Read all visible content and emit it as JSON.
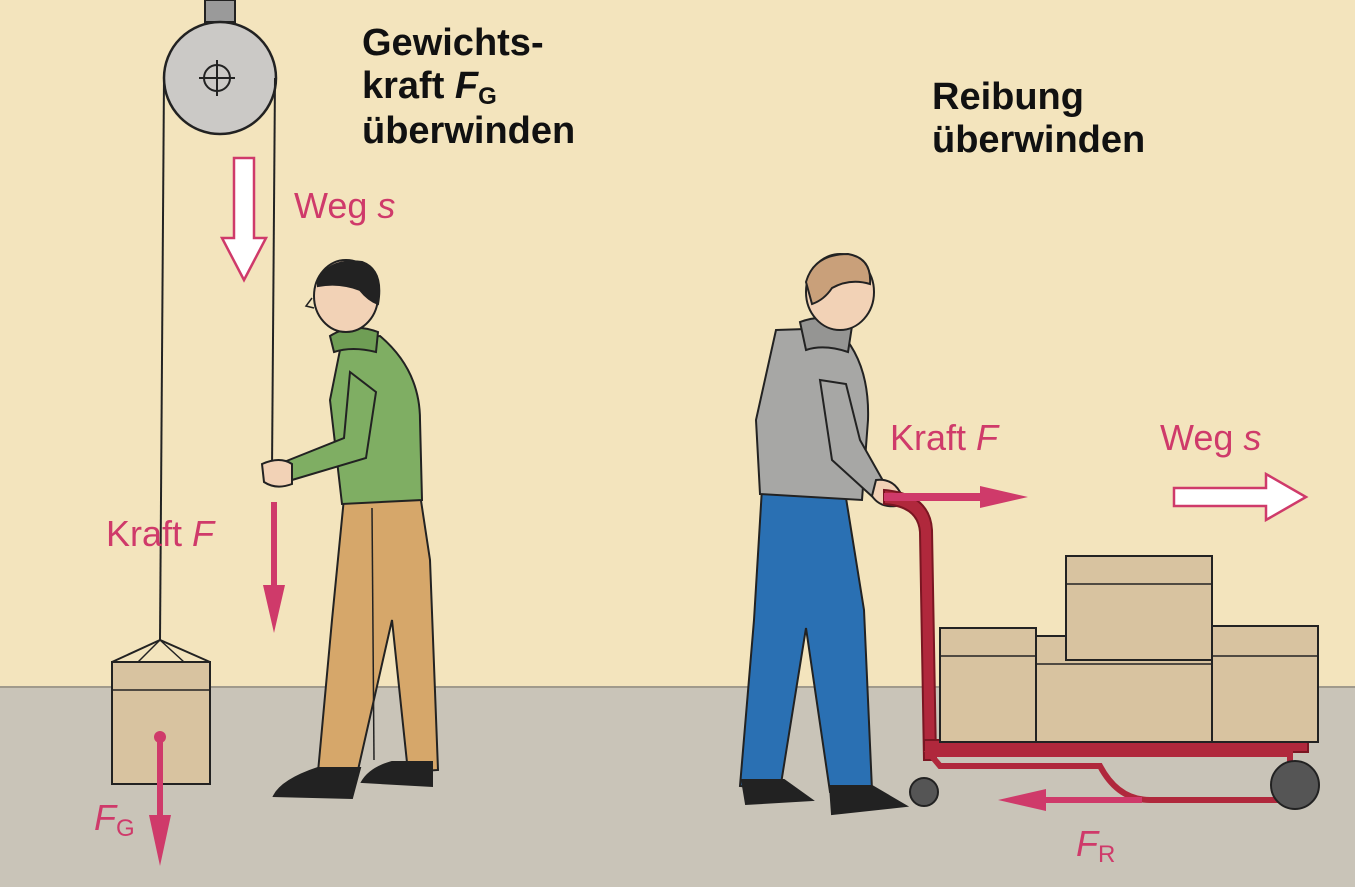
{
  "left_heading": {
    "line1": "Gewichts-",
    "line2_prefix": "kraft ",
    "line2_symbol": "F",
    "line2_subscript": "G",
    "line3": "überwinden"
  },
  "right_heading": {
    "line1": "Reibung",
    "line2": "überwinden"
  },
  "labels": {
    "weg_left_word": "Weg",
    "weg_left_symbol": "s",
    "kraft_left_word": "Kraft",
    "kraft_left_symbol": "F",
    "fg_symbol": "F",
    "fg_subscript": "G",
    "kraft_right_word": "Kraft",
    "kraft_right_symbol": "F",
    "weg_right_word": "Weg",
    "weg_right_symbol": "s",
    "fr_symbol": "F",
    "fr_subscript": "R"
  },
  "colors": {
    "background": "#f3e4bd",
    "floor": "#c9c4b8",
    "arrow": "#cf3a6a",
    "box": "#d8c3a0",
    "trolley": "#b0283c",
    "green_sweater": "#7fae63",
    "grey_sweater": "#a7a7a5",
    "tan_pants": "#d6a76a",
    "blue_pants": "#2a70b3"
  }
}
